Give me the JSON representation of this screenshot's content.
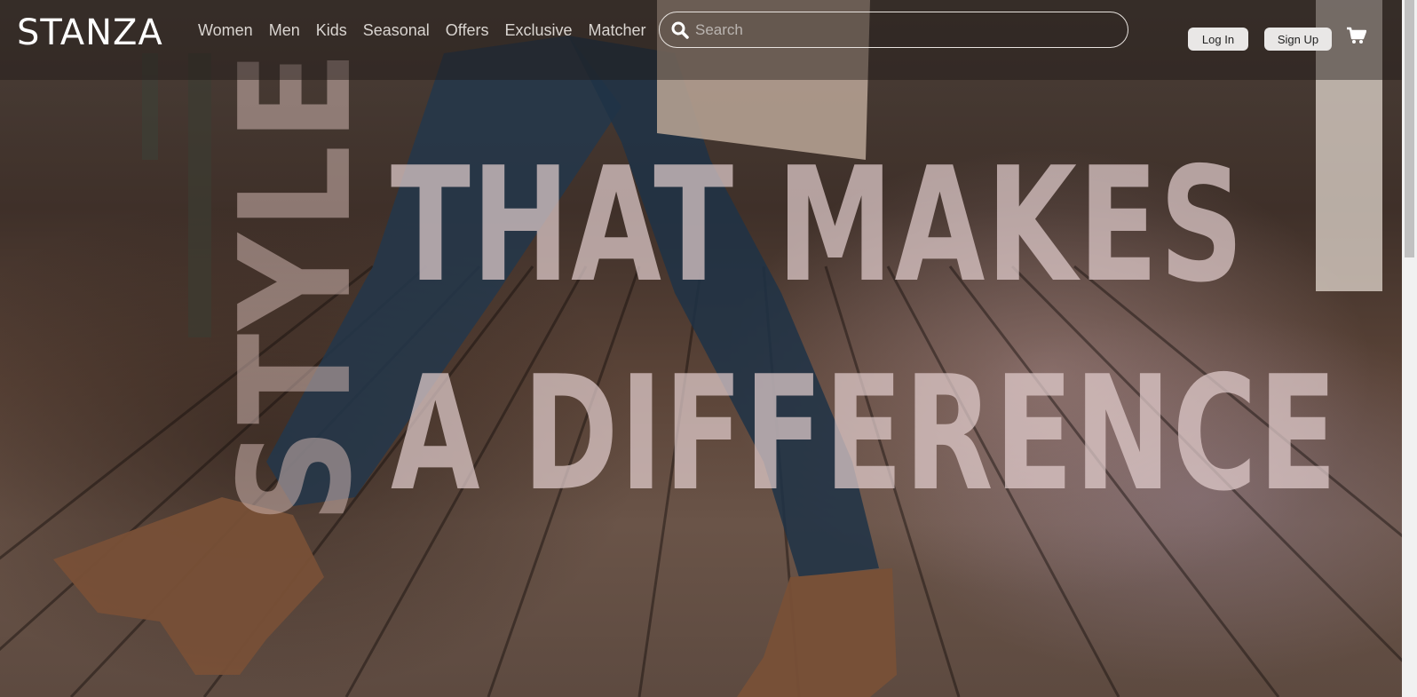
{
  "brand": {
    "logo_text": "STANZA"
  },
  "nav": {
    "items": [
      {
        "label": "Women"
      },
      {
        "label": "Men"
      },
      {
        "label": "Kids"
      },
      {
        "label": "Seasonal"
      },
      {
        "label": "Offers"
      },
      {
        "label": "Exclusive"
      },
      {
        "label": "Matcher"
      }
    ]
  },
  "search": {
    "placeholder": "Search",
    "value": "",
    "icon": "search-icon"
  },
  "auth": {
    "login_label": "Log In",
    "signup_label": "Sign Up"
  },
  "cart": {
    "icon": "cart-icon"
  },
  "hero": {
    "headline_vertical": "STYLE",
    "headline_line1": "THAT MAKES",
    "headline_line2": "A DIFFERENCE"
  },
  "colors": {
    "header_overlay": "#1e1816",
    "nav_text": "#d9d4d0",
    "button_bg": "#e9e7e6",
    "headline": "#e2cdcd"
  }
}
